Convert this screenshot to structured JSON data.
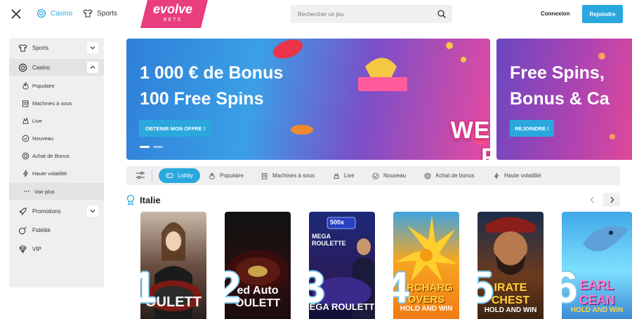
{
  "header": {
    "nav": {
      "casino": "Casino",
      "sports": "Sports"
    },
    "logo": {
      "word": "evolve",
      "sub": "BETS"
    },
    "search": {
      "placeholder": "Rechercher un jeu"
    },
    "login_label": "Connexion",
    "join_label": "Rejoindre"
  },
  "sidebar": {
    "items": [
      {
        "label": "Sports",
        "icon": "shirt-icon",
        "expanded": false
      },
      {
        "label": "Casino",
        "icon": "chip-icon",
        "expanded": true
      },
      {
        "label": "Populaire",
        "icon": "flame-icon"
      },
      {
        "label": "Machines à sous",
        "icon": "slot-machine-icon"
      },
      {
        "label": "Live",
        "icon": "dealer-icon"
      },
      {
        "label": "Nouveau",
        "icon": "check-circle-icon"
      },
      {
        "label": "Achat de Bonus",
        "icon": "bonus-icon"
      },
      {
        "label": "Haute volatilité",
        "icon": "lightning-icon"
      },
      {
        "label": "Voir plus",
        "icon": "more-icon"
      },
      {
        "label": "Promotions",
        "icon": "rocket-icon",
        "expanded": false
      },
      {
        "label": "Fidélité",
        "icon": "bomb-icon"
      },
      {
        "label": "VIP",
        "icon": "diamond-icon"
      }
    ]
  },
  "banners": [
    {
      "line1": "1 000 € de Bonus",
      "line2": "100 Free Spins",
      "button": "OBTENIR MON OFFRE !",
      "art_text_1": "WELCOME",
      "art_text_2": "PACK"
    },
    {
      "line1": "Free Spins,",
      "line2": "Bonus & Ca",
      "button": "REJOINDRE !"
    }
  ],
  "filters": [
    {
      "label": "Lobby",
      "icon": "lobby-icon",
      "active": true
    },
    {
      "label": "Populaire",
      "icon": "flame-icon"
    },
    {
      "label": "Machines à sous",
      "icon": "slot-machine-icon"
    },
    {
      "label": "Live",
      "icon": "dealer-icon"
    },
    {
      "label": "Nouveau",
      "icon": "check-circle-icon"
    },
    {
      "label": "Achat de bonus",
      "icon": "bonus-icon"
    },
    {
      "label": "Haute volatilité",
      "icon": "lightning-icon"
    }
  ],
  "section": {
    "title": "Italie",
    "cards": [
      {
        "rank": "1",
        "title": "OULETT",
        "colors": [
          "#c9b9a8",
          "#3b2f2a"
        ]
      },
      {
        "rank": "2",
        "title": "ed Auto OULETT",
        "colors": [
          "#1a1a1a",
          "#5a1010"
        ]
      },
      {
        "rank": "3",
        "title": "EGA ROULETT",
        "badge": "500x",
        "top_text": "MEGA ROULETTE",
        "colors": [
          "#1c2a7a",
          "#0d0f35"
        ]
      },
      {
        "rank": "4",
        "title": "ERCHARG OVERS",
        "sub": "HOLD AND WIN",
        "colors": [
          "#ffb21e",
          "#3fa4e0"
        ]
      },
      {
        "rank": "5",
        "title": "IRATE CHEST",
        "sub": "HOLD AND WIN",
        "colors": [
          "#6b3b1f",
          "#1a2d4a"
        ]
      },
      {
        "rank": "6",
        "title": "EARL CEAN",
        "sub": "HOLD AND WIN",
        "colors": [
          "#3fa8e8",
          "#7ee0ff"
        ]
      }
    ]
  },
  "colors": {
    "accent": "#2aa8dd",
    "brand_pink": "#e83e7e"
  }
}
